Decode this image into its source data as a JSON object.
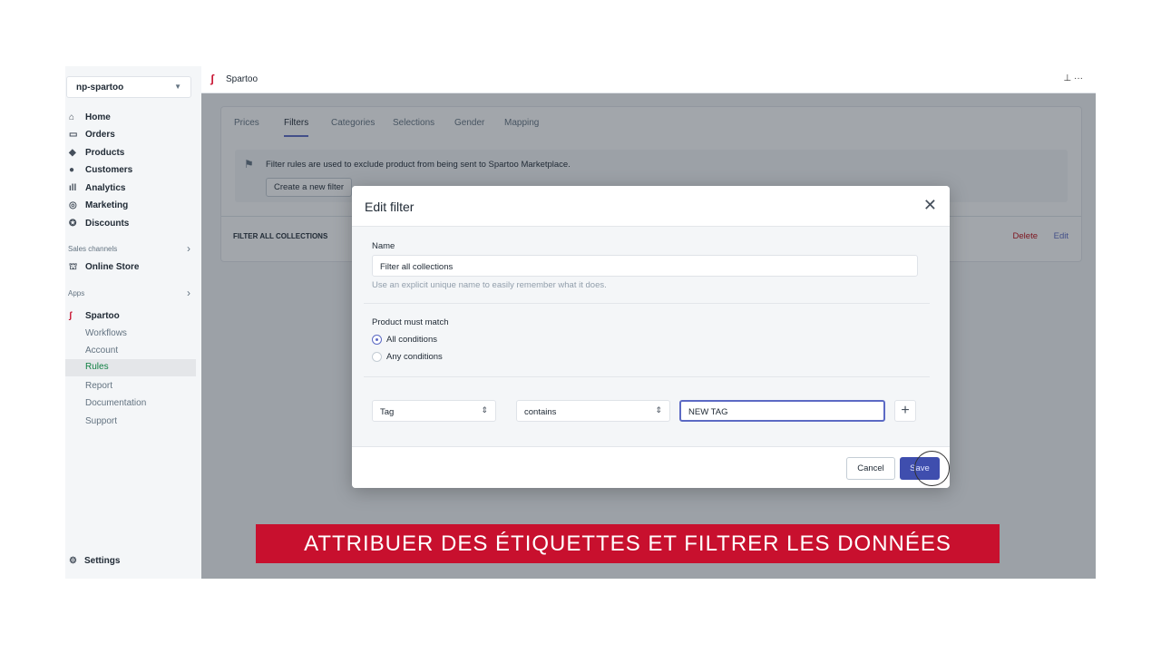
{
  "sidebar": {
    "store": "np-spartoo",
    "nav": [
      {
        "label": "Home",
        "icon": "home-icon"
      },
      {
        "label": "Orders",
        "icon": "orders-icon"
      },
      {
        "label": "Products",
        "icon": "tag-icon"
      },
      {
        "label": "Customers",
        "icon": "person-icon"
      },
      {
        "label": "Analytics",
        "icon": "chart-icon"
      },
      {
        "label": "Marketing",
        "icon": "marketing-icon"
      },
      {
        "label": "Discounts",
        "icon": "discount-icon"
      }
    ],
    "sales_channels": "Sales channels",
    "online_store": "Online Store",
    "apps": "Apps",
    "app_name": "Spartoo",
    "app_items": [
      "Workflows",
      "Account",
      "Rules",
      "Report",
      "Documentation",
      "Support"
    ],
    "active_item": "Rules",
    "settings": "Settings"
  },
  "topbar": {
    "title": "Spartoo"
  },
  "tabs": [
    "Prices",
    "Filters",
    "Categories",
    "Selections",
    "Gender",
    "Mapping"
  ],
  "active_tab": "Filters",
  "banner": {
    "text": "Filter rules are used to exclude product from being sent to Spartoo Marketplace.",
    "button": "Create a new filter"
  },
  "rule": {
    "name": "FILTER ALL COLLECTIONS",
    "delete": "Delete",
    "edit": "Edit"
  },
  "modal": {
    "title": "Edit filter",
    "name_label": "Name",
    "name_value": "Filter all collections",
    "name_help": "Use an explicit unique name to easily remember what it does.",
    "match_label": "Product must match",
    "options": [
      "All conditions",
      "Any conditions"
    ],
    "selected_option": "All conditions",
    "condition": {
      "field": "Tag",
      "operator": "contains",
      "value": "NEW TAG"
    },
    "cancel": "Cancel",
    "save": "Save"
  },
  "caption": "ATTRIBUER DES ÉTIQUETTES ET FILTRER LES DONNÉES",
  "colors": {
    "accent": "#5c6ac4",
    "primary_button": "#3f4eae",
    "caption_bg": "#c8102e",
    "delete": "#bf0711"
  }
}
